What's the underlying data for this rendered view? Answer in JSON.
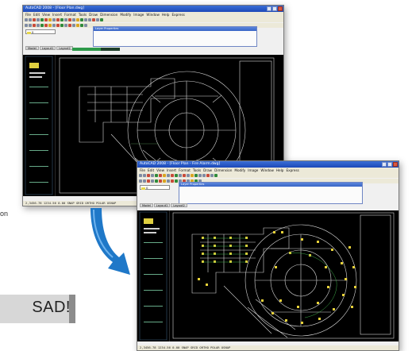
{
  "window_top": {
    "title": "AutoCAD 2008 - [Floor Plan.dwg]",
    "menus": [
      "File",
      "Edit",
      "View",
      "Insert",
      "Format",
      "Tools",
      "Draw",
      "Dimension",
      "Modify",
      "Image",
      "Window",
      "Help",
      "Express"
    ],
    "float_title": "Layer Properties",
    "layer": "0",
    "tabs": [
      "Model",
      "Layout1",
      "Layout2"
    ],
    "status": "2,3456.78  1234.56  0.00  SNAP GRID ORTHO POLAR OSNAP"
  },
  "window_bottom": {
    "title": "AutoCAD 2008 - [Floor Plan - Fire Alarm.dwg]",
    "menus": [
      "File",
      "Edit",
      "View",
      "Insert",
      "Format",
      "Tools",
      "Draw",
      "Dimension",
      "Modify",
      "Image",
      "Window",
      "Help",
      "Express"
    ],
    "float_title": "Layer Properties",
    "layer": "0",
    "tabs": [
      "Model",
      "Layout1",
      "Layout2"
    ],
    "status": "2,3456.78  1234.56  0.00  SNAP GRID ORTHO POLAR OSNAP"
  },
  "side_note": "on",
  "banner_text": "SAD!",
  "colors": {
    "arrow": "#1f78c8",
    "canvas": "#000000",
    "symbol": "#e8d23a",
    "linework": "#d8d8d8"
  }
}
